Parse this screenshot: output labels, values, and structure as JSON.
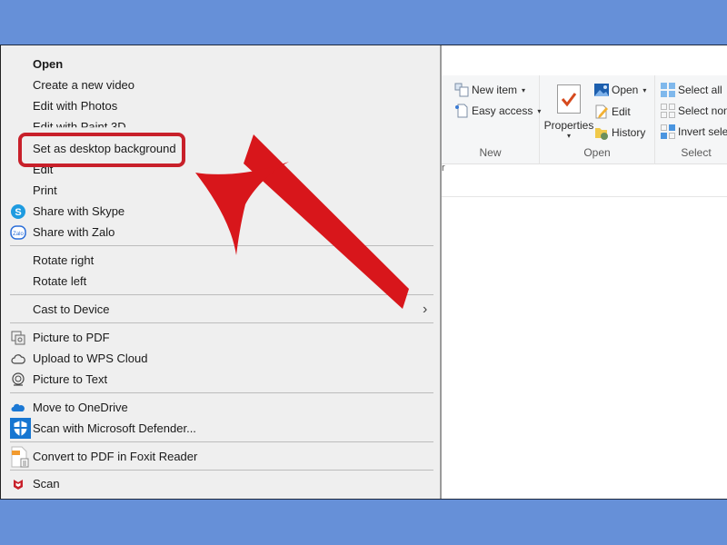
{
  "context_menu": {
    "items": [
      {
        "label": "Open",
        "bold": true
      },
      {
        "label": "Create a new video"
      },
      {
        "label": "Edit with Photos"
      },
      {
        "label": "Edit with Paint 3D"
      },
      {
        "label": "Set as desktop background",
        "highlighted": true
      },
      {
        "label": "Edit"
      },
      {
        "label": "Print"
      },
      {
        "label": "Share with Skype",
        "icon": "skype-icon"
      },
      {
        "label": "Share with Zalo",
        "icon": "zalo-icon"
      },
      {
        "label": "Rotate right"
      },
      {
        "label": "Rotate left"
      },
      {
        "label": "Cast to Device",
        "submenu": true
      },
      {
        "label": "Picture to PDF",
        "icon": "picture-to-pdf-icon"
      },
      {
        "label": "Upload to WPS Cloud",
        "icon": "cloud-icon"
      },
      {
        "label": "Picture to Text",
        "icon": "picture-to-text-icon"
      },
      {
        "label": "Move to OneDrive",
        "icon": "onedrive-icon"
      },
      {
        "label": "Scan with Microsoft Defender...",
        "icon": "defender-shield-icon"
      },
      {
        "label": "Convert to PDF in Foxit Reader",
        "icon": "foxit-icon"
      },
      {
        "label": "Scan",
        "icon": "mcafee-icon"
      }
    ],
    "submenu_arrow": "›"
  },
  "ribbon": {
    "left_edge_char": "r",
    "groups": {
      "new": {
        "label": "New",
        "new_item": "New item",
        "easy_access": "Easy access"
      },
      "open": {
        "label": "Open",
        "properties": "Properties",
        "open": "Open",
        "edit": "Edit",
        "history": "History"
      },
      "select": {
        "label": "Select",
        "select_all": "Select all",
        "select_none": "Select none",
        "invert_selection": "Invert selection"
      }
    },
    "caret": "▾"
  },
  "annotation": {
    "color": "#d8161b",
    "box_color": "#c8202a"
  },
  "colors": {
    "background": "#6690d8",
    "menu_bg": "#efefef",
    "ribbon_bg": "#f5f6f7"
  }
}
